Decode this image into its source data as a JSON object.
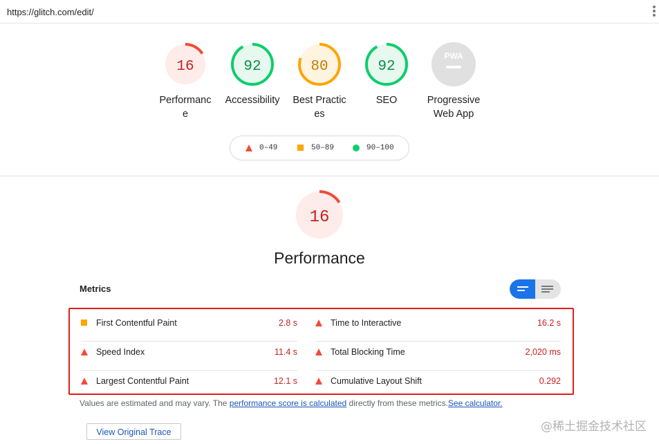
{
  "browser": {
    "url": "https://glitch.com/edit/"
  },
  "gauges": [
    {
      "label": "Performance",
      "score": "16",
      "value": 16,
      "color": "#f04b3a",
      "bg": "#fdecea"
    },
    {
      "label": "Accessibility",
      "score": "92",
      "value": 92,
      "color": "#0cce6b",
      "bg": "#e7f8ef"
    },
    {
      "label": "Best Practices",
      "score": "80",
      "value": 80,
      "color": "#ffa400",
      "bg": "#fff4e0"
    },
    {
      "label": "SEO",
      "score": "92",
      "value": 92,
      "color": "#0cce6b",
      "bg": "#e7f8ef"
    },
    {
      "label": "Progressive Web App",
      "score": "PWA",
      "value": null,
      "color": "#b0b0b0",
      "bg": "#e0e0e0"
    }
  ],
  "legend": [
    {
      "range": "0–49",
      "shape": "triangle",
      "color": "#f04b3a"
    },
    {
      "range": "50–89",
      "shape": "square",
      "color": "#ffa400"
    },
    {
      "range": "90–100",
      "shape": "circle",
      "color": "#0cce6b"
    }
  ],
  "performance": {
    "score": "16",
    "value": 16,
    "title": "Performance"
  },
  "metrics_header": "Metrics",
  "metrics": {
    "left": [
      {
        "name": "First Contentful Paint",
        "value": "2.8 s",
        "shape": "square",
        "color": "#ffa400"
      },
      {
        "name": "Speed Index",
        "value": "11.4 s",
        "shape": "triangle",
        "color": "#f04b3a"
      },
      {
        "name": "Largest Contentful Paint",
        "value": "12.1 s",
        "shape": "triangle",
        "color": "#f04b3a"
      }
    ],
    "right": [
      {
        "name": "Time to Interactive",
        "value": "16.2 s",
        "shape": "triangle",
        "color": "#f04b3a"
      },
      {
        "name": "Total Blocking Time",
        "value": "2,020 ms",
        "shape": "triangle",
        "color": "#f04b3a"
      },
      {
        "name": "Cumulative Layout Shift",
        "value": "0.292",
        "shape": "triangle",
        "color": "#f04b3a"
      }
    ]
  },
  "note": {
    "prefix": "Values are estimated and may vary. The ",
    "link1": "performance score is calculated",
    "middle": " directly from these metrics.",
    "link2": "See calculator."
  },
  "trace_button": "View Original Trace",
  "watermark": "@稀土掘金技术社区"
}
